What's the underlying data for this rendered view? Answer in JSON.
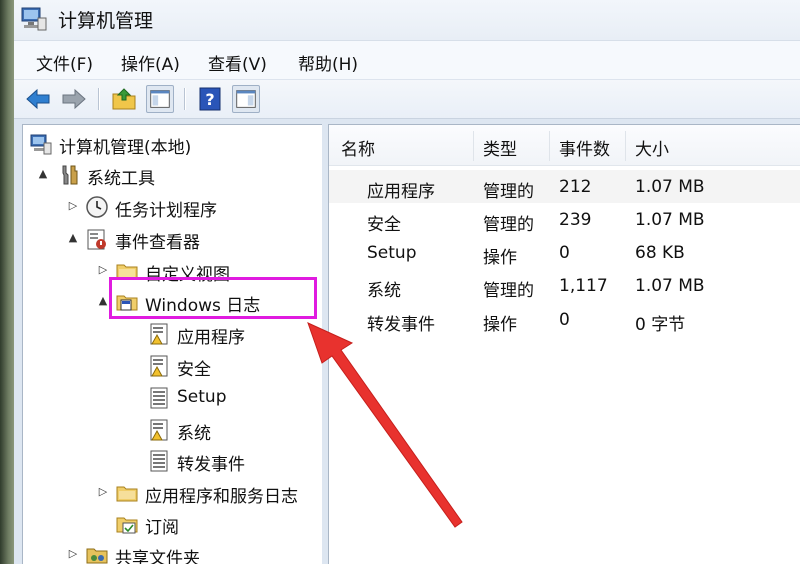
{
  "window": {
    "title": "计算机管理"
  },
  "menu": [
    "文件(F)",
    "操作(A)",
    "查看(V)",
    "帮助(H)"
  ],
  "toolbar": {
    "buttons": [
      "back-icon",
      "forward-icon",
      "up-folder-icon",
      "show-hide-tree-icon",
      "help-icon",
      "show-hide-action-pane-icon"
    ]
  },
  "tree": [
    {
      "label": "计算机管理(本地)",
      "icon": "computer-management-icon",
      "arrow": ""
    },
    {
      "label": "系统工具",
      "icon": "system-tools-icon",
      "arrow": "▲"
    },
    {
      "label": "任务计划程序",
      "icon": "task-scheduler-icon",
      "arrow": "▷"
    },
    {
      "label": "事件查看器",
      "icon": "event-viewer-icon",
      "arrow": "▲"
    },
    {
      "label": "自定义视图",
      "icon": "folder-icon",
      "arrow": "▷"
    },
    {
      "label": "Windows 日志",
      "icon": "windows-logs-folder-icon",
      "arrow": "▲"
    },
    {
      "label": "应用程序",
      "icon": "log-icon",
      "arrow": ""
    },
    {
      "label": "安全",
      "icon": "log-icon",
      "arrow": ""
    },
    {
      "label": "Setup",
      "icon": "log-plain-icon",
      "arrow": ""
    },
    {
      "label": "系统",
      "icon": "log-icon",
      "arrow": ""
    },
    {
      "label": "转发事件",
      "icon": "log-plain-icon",
      "arrow": ""
    },
    {
      "label": "应用程序和服务日志",
      "icon": "folder-icon",
      "arrow": "▷"
    },
    {
      "label": "订阅",
      "icon": "subscription-icon",
      "arrow": ""
    },
    {
      "label": "共享文件夹",
      "icon": "shared-folders-icon",
      "arrow": "▷"
    }
  ],
  "list": {
    "columns": [
      "名称",
      "类型",
      "事件数",
      "大小"
    ],
    "rows": [
      [
        "应用程序",
        "管理的",
        "212",
        "1.07 MB"
      ],
      [
        "安全",
        "管理的",
        "239",
        "1.07 MB"
      ],
      [
        "Setup",
        "操作",
        "0",
        "68 KB"
      ],
      [
        "系统",
        "管理的",
        "1,117",
        "1.07 MB"
      ],
      [
        "转发事件",
        "操作",
        "0",
        "0 字节"
      ]
    ]
  },
  "colors": {
    "highlight": "#e01be0",
    "annotation_arrow": "#e8322e"
  }
}
